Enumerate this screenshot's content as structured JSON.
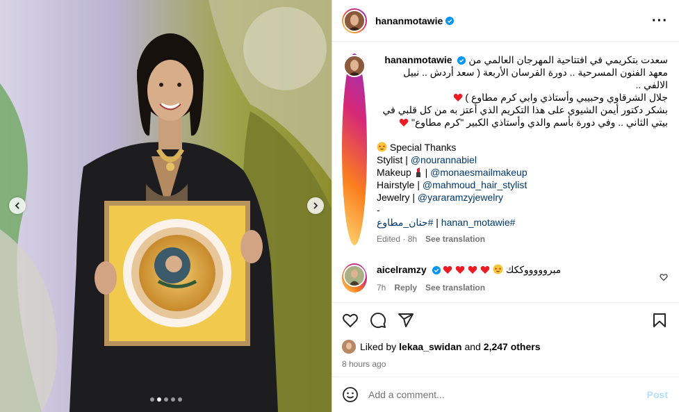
{
  "post": {
    "author": "hananmotawie",
    "more_icon": "more-horizontal-icon",
    "caption": {
      "line1": "سعدت بتكريمي في افتتاحية المهرجان العالمي من",
      "line2": "معهد الفنون المسرحية .. دورة الفرسان الأربعة ( سعد أردش .. نبيل الالفي ..",
      "line3": "جلال الشرقاوي وحبيبي وأستاذي وابي كرم مطاوع )",
      "line4": "بشكر دكتور أيمن الشيوي على هذا التكريم الذي أعتز به من كل قلبي في",
      "line5": "بيتي الثاني .. وفي دورة بأسم والدي وأستاذي الكبير \"كرم مطاوع\"",
      "thanks": "Special Thanks",
      "credits": [
        {
          "label": "Stylist |",
          "handle": "@nourannabiel"
        },
        {
          "label": "Makeup",
          "handle": "@monaesmailmakeup"
        },
        {
          "label": "Hairstyle |",
          "handle": "@mahmoud_hair_stylist"
        },
        {
          "label": "Jewelry |",
          "handle": "@yararamzyjewelry"
        }
      ],
      "dash": "-",
      "tag1": "حنان_مطاوع#",
      "sep": "|",
      "tag2": "hanan_motawie#",
      "edited": "Edited · 8h",
      "see_translation": "See translation"
    },
    "comment": {
      "author": "aicelramzy",
      "text": "مبروووووككك",
      "time": "7h",
      "reply": "Reply",
      "see_translation": "See translation"
    },
    "likes": {
      "prefix": "Liked by",
      "user": "lekaa_swidan",
      "and": "and",
      "others": "2,247 others"
    },
    "posted_ago": "8 hours ago",
    "add_comment_placeholder": "Add a comment...",
    "post_label": "Post"
  },
  "carousel": {
    "slides": 5,
    "active_index": 1
  },
  "colors": {
    "link": "#00376b",
    "muted": "#737373",
    "post_disabled": "#b2dffc",
    "heart": "#ed1c24"
  }
}
